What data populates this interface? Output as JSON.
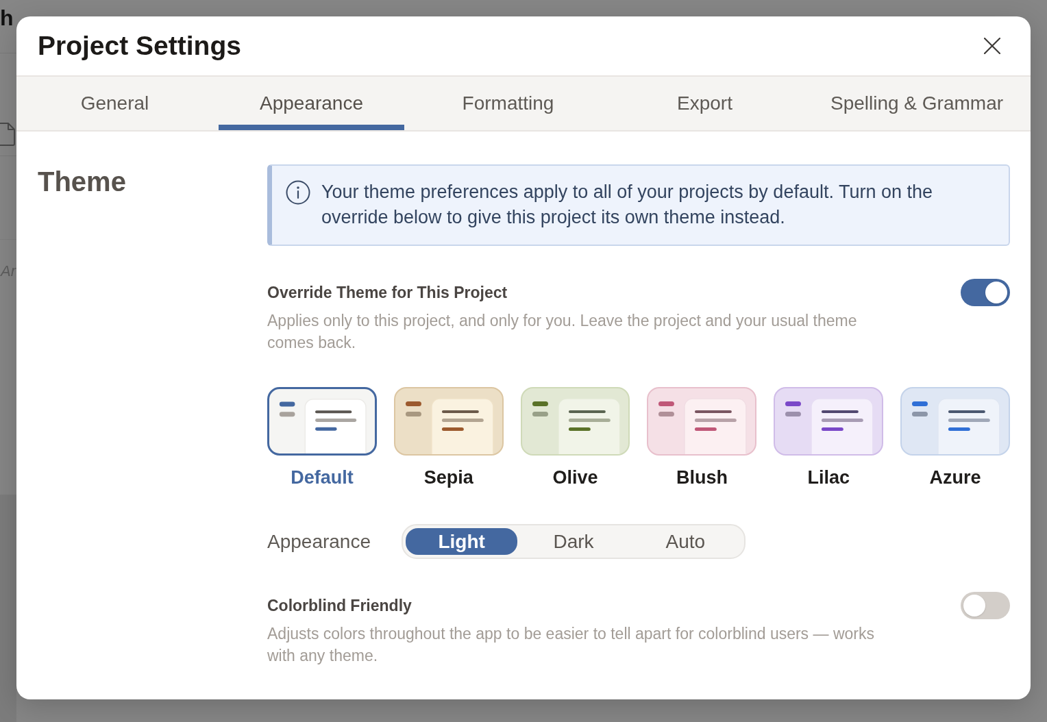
{
  "backdrop": {
    "heading_fragment": "h",
    "text_fragment": "Ar"
  },
  "dialog": {
    "title": "Project Settings"
  },
  "tabs": [
    {
      "label": "General",
      "selected": false
    },
    {
      "label": "Appearance",
      "selected": true
    },
    {
      "label": "Formatting",
      "selected": false
    },
    {
      "label": "Export",
      "selected": false
    },
    {
      "label": "Spelling & Grammar",
      "selected": false
    }
  ],
  "section_title": "Theme",
  "info_banner": {
    "text": "Your theme preferences apply to all of your projects by default. Turn on the override below to give this project its own theme instead."
  },
  "override": {
    "label": "Override Theme for This Project",
    "description": "Applies only to this project, and only for you. Leave the project and your usual theme comes back.",
    "on": true
  },
  "themes": [
    {
      "name": "Default",
      "selected": true,
      "color": "#4468a0"
    },
    {
      "name": "Sepia",
      "selected": false,
      "color": "#9c5a2e"
    },
    {
      "name": "Olive",
      "selected": false,
      "color": "#5a7228"
    },
    {
      "name": "Blush",
      "selected": false,
      "color": "#c05878"
    },
    {
      "name": "Lilac",
      "selected": false,
      "color": "#7a48c8"
    },
    {
      "name": "Azure",
      "selected": false,
      "color": "#2f6fd6"
    }
  ],
  "appearance": {
    "label": "Appearance",
    "options": [
      {
        "label": "Light",
        "selected": true
      },
      {
        "label": "Dark",
        "selected": false
      },
      {
        "label": "Auto",
        "selected": false
      }
    ]
  },
  "colorblind": {
    "label": "Colorblind Friendly",
    "description": "Adjusts colors throughout the app to be easier to tell apart for colorblind users — works with any theme.",
    "on": false
  }
}
